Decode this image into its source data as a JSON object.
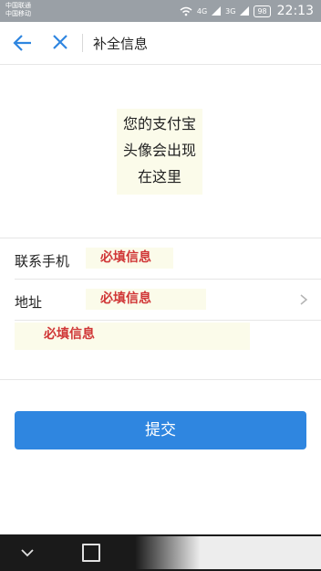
{
  "status_bar": {
    "carrier_1": "中国联通",
    "carrier_2": "中国移动",
    "signal_1": "4G",
    "signal_2": "3G",
    "battery": "98",
    "time": "22:13"
  },
  "header": {
    "title": "补全信息",
    "back_icon": "arrow-left-icon",
    "close_icon": "close-icon"
  },
  "avatar_note": {
    "line_1": "您的支付宝",
    "line_2": "头像会出现",
    "line_3": "在这里"
  },
  "form": {
    "phone_label": "联系手机",
    "phone_note": "必填信息",
    "address_label": "地址",
    "address_note": "必填信息",
    "detail_note": "必填信息"
  },
  "submit_label": "提交",
  "colors": {
    "accent": "#2f86e0",
    "note_text": "#d03636",
    "note_bg": "#fbfbea"
  }
}
